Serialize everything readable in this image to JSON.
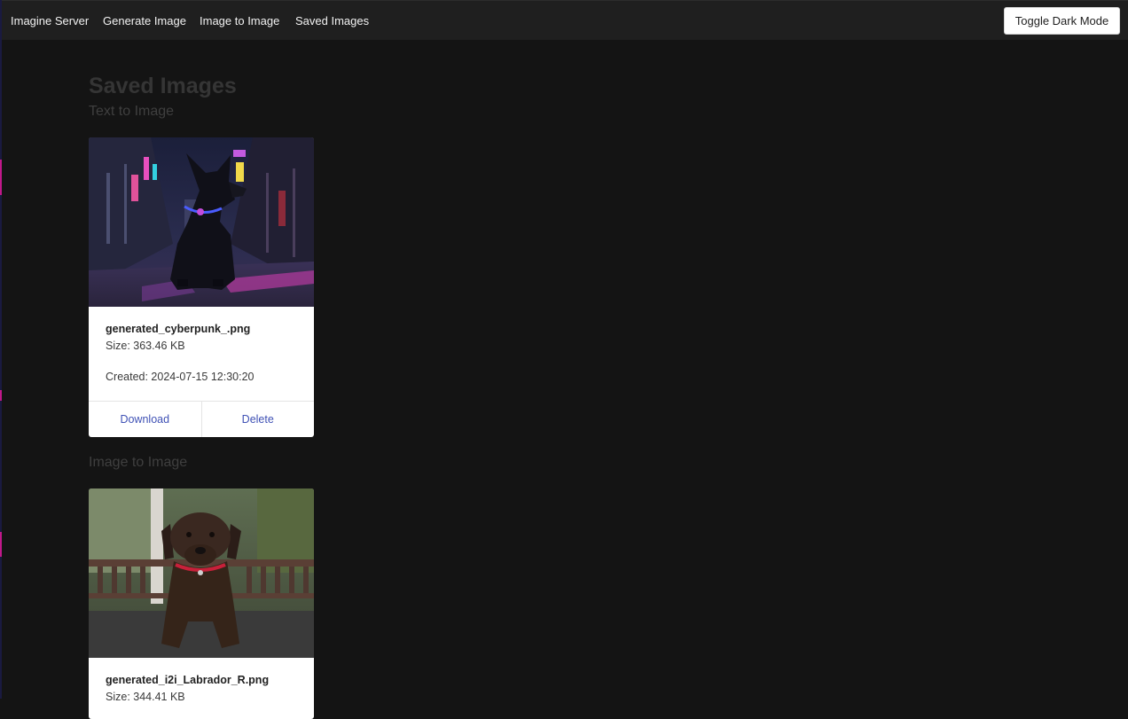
{
  "nav": {
    "brand": "Imagine Server",
    "links": [
      "Generate Image",
      "Image to Image",
      "Saved Images"
    ],
    "toggle_label": "Toggle Dark Mode"
  },
  "page": {
    "title": "Saved Images"
  },
  "sections": [
    {
      "heading": "Text to Image",
      "cards": [
        {
          "image_subject": "black dog sitting in neon-lit cyberpunk alley",
          "name": "generated_cyberpunk_.png",
          "size": "Size: 363.46 KB",
          "created": "Created: 2024-07-15 12:30:20",
          "download_label": "Download",
          "delete_label": "Delete"
        }
      ]
    },
    {
      "heading": "Image to Image",
      "cards": [
        {
          "image_subject": "chocolate labrador puppy with red collar on a deck",
          "name": "generated_i2i_Labrador_R.png",
          "size": "Size: 344.41 KB"
        }
      ]
    }
  ],
  "colors": {
    "background": "#141414",
    "topbar": "#1f1f1f",
    "link_accent": "#3f51b5",
    "card": "#ffffff"
  }
}
